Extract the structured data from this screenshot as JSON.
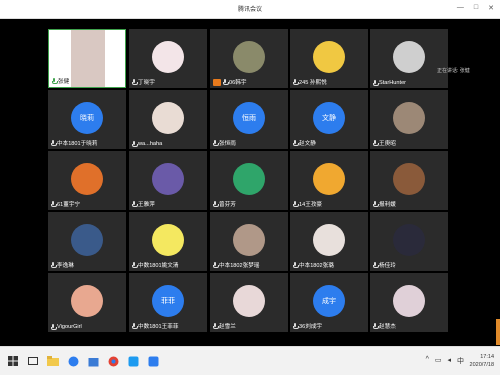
{
  "window": {
    "title": "腾讯会议"
  },
  "speaking_label": "正在讲话: 张健",
  "tiles": [
    {
      "name": "张健",
      "type": "photo",
      "color": "#d9c8c2",
      "active": true
    },
    {
      "name": "丁晓宇",
      "type": "photo",
      "color": "#f3e5e8"
    },
    {
      "name": "06韩宇",
      "type": "photo",
      "color": "#8a8a6a",
      "badge": true
    },
    {
      "name": "245 孙熙悦",
      "type": "photo",
      "color": "#f0c842"
    },
    {
      "name": "StarHunter",
      "type": "photo",
      "color": "#cfcfcf"
    },
    {
      "name": "中本1801于晓莉",
      "type": "text",
      "initials": "晓莉"
    },
    {
      "name": "wa...haha",
      "type": "photo",
      "color": "#e9dcd4"
    },
    {
      "name": "张恒雨",
      "type": "text",
      "initials": "恒雨"
    },
    {
      "name": "赵文静",
      "type": "text",
      "initials": "文静"
    },
    {
      "name": "王庚昭",
      "type": "photo",
      "color": "#9c8876"
    },
    {
      "name": "61董宇宁",
      "type": "photo",
      "color": "#e0702a"
    },
    {
      "name": "王雅萍",
      "type": "photo",
      "color": "#6a5aa8"
    },
    {
      "name": "曾芬芳",
      "type": "photo",
      "color": "#2fa56a"
    },
    {
      "name": "14王孜豪",
      "type": "photo",
      "color": "#f0a830"
    },
    {
      "name": "报利媛",
      "type": "photo",
      "color": "#8a5a3a"
    },
    {
      "name": "李逸琳",
      "type": "photo",
      "color": "#3a5a8a"
    },
    {
      "name": "中数1801姚文清",
      "type": "photo",
      "color": "#f4e860"
    },
    {
      "name": "中本1802张梦瑶",
      "type": "photo",
      "color": "#b09888"
    },
    {
      "name": "中本1802张璐",
      "type": "photo",
      "color": "#e8e0dc"
    },
    {
      "name": "杨佳玲",
      "type": "photo",
      "color": "#2a2a3a"
    },
    {
      "name": "VigourGirl",
      "type": "photo",
      "color": "#e8a890"
    },
    {
      "name": "中数1801王菲菲",
      "type": "text",
      "initials": "菲菲"
    },
    {
      "name": "赵雪兰",
      "type": "photo",
      "color": "#e8d8d8"
    },
    {
      "name": "36刘成宇",
      "type": "text",
      "initials": "成宇"
    },
    {
      "name": "赵慧杰",
      "type": "photo",
      "color": "#e0d0d8"
    }
  ],
  "taskbar": {
    "time": "17:14",
    "date": "2020/7/18",
    "tray_text": "中"
  },
  "colors": {
    "accent": "#2d7dee",
    "active_border": "#3fa34d"
  }
}
